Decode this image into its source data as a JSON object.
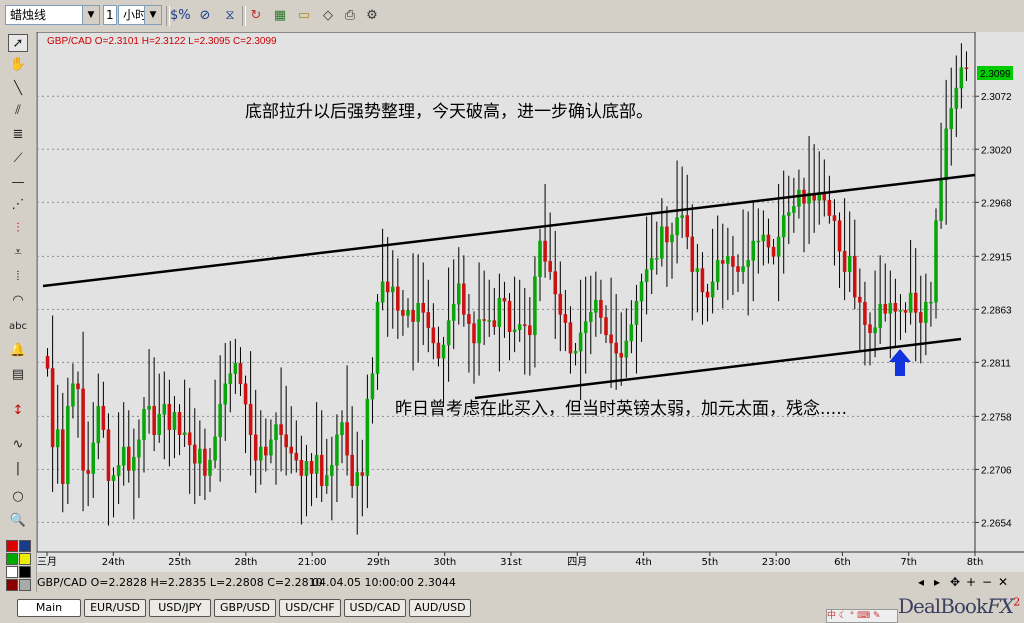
{
  "toolbar": {
    "chart_style": "蜡烛线",
    "period_value": "1",
    "period_unit": "小时",
    "buttons": [
      "percent-icon",
      "percent-strike-icon",
      "crosshair-filter-icon",
      "chart-refresh-icon",
      "add-chart-icon",
      "folder-icon",
      "print-icon",
      "settings-icon"
    ]
  },
  "left_tools": [
    "cursor",
    "hand",
    "line",
    "parallel-lines",
    "fibonacci",
    "fan",
    "horizontal-line",
    "gann-fan",
    "andrews-pitchfork",
    "regression",
    "cycles",
    "text",
    "alert",
    "calculator",
    "arrows",
    "wave",
    "vertical-line",
    "ellipse",
    "zoom"
  ],
  "colors": {
    "chart_bg": "#e2e2e2",
    "bull": "#0aa50a",
    "bear": "#cc1111",
    "grid": "#8c8c8c",
    "price_box": "#00cc00",
    "arrow": "#1133dd",
    "header_text": "#cc0000"
  },
  "chart_data": {
    "type": "candlestick",
    "header": "GBP/CAD O=2.3101 H=2.3122 L=2.3095 C=2.3099",
    "current_price": "2.3099",
    "y_ticks": [
      "2.3072",
      "2.3020",
      "2.2968",
      "2.2915",
      "2.2863",
      "2.2811",
      "2.2758",
      "2.2706",
      "2.2654"
    ],
    "x_ticks": [
      "三月",
      "24th",
      "25th",
      "28th",
      "21:00",
      "29th",
      "30th",
      "31st",
      "四月",
      "4th",
      "5th",
      "23:00",
      "6th",
      "7th",
      "8th"
    ],
    "ylim": [
      2.2625,
      2.3135
    ],
    "annotation_top": "底部拉升以后强势整理，今天破高，进一步确认底部。",
    "annotation_bottom": "昨日曾考虑在此买入，但当时英镑太弱，加元太面，残念.....",
    "closes": [
      2.2805,
      2.2728,
      2.2745,
      2.2692,
      2.2768,
      2.279,
      2.2785,
      2.2705,
      2.2702,
      2.2732,
      2.2768,
      2.2745,
      2.2695,
      2.27,
      2.271,
      2.2728,
      2.2705,
      2.2718,
      2.2735,
      2.2765,
      2.2768,
      2.274,
      2.276,
      2.277,
      2.2745,
      2.2762,
      2.274,
      2.2742,
      2.273,
      2.2712,
      2.2726,
      2.27,
      2.2715,
      2.2738,
      2.277,
      2.279,
      2.28,
      2.281,
      2.279,
      2.277,
      2.274,
      2.2715,
      2.2728,
      2.272,
      2.2735,
      2.275,
      2.274,
      2.2728,
      2.2722,
      2.2715,
      2.27,
      2.2714,
      2.2702,
      2.272,
      2.269,
      2.27,
      2.271,
      2.274,
      2.2752,
      2.272,
      2.269,
      2.2703,
      2.27,
      2.2775,
      2.28,
      2.287,
      2.289,
      2.288,
      2.2885,
      2.2862,
      2.2857,
      2.2862,
      2.2851,
      2.2869,
      2.286,
      2.2845,
      2.283,
      2.2815,
      2.2828,
      2.2852,
      2.2868,
      2.2888,
      2.2858,
      2.2849,
      2.283,
      2.2853,
      2.2852,
      2.2852,
      2.2846,
      2.2874,
      2.2871,
      2.2841,
      2.2843,
      2.2848,
      2.2847,
      2.2838,
      2.2895,
      2.293,
      2.291,
      2.29,
      2.2878,
      2.2858,
      2.285,
      2.282,
      2.2822,
      2.284,
      2.2851,
      2.286,
      2.2872,
      2.2855,
      2.2838,
      2.283,
      2.282,
      2.2816,
      2.2832,
      2.2848,
      2.2871,
      2.289,
      2.2902,
      2.2913,
      2.2913,
      2.2944,
      2.2929,
      2.2936,
      2.2953,
      2.2955,
      2.2934,
      2.29,
      2.2903,
      2.288,
      2.2875,
      2.289,
      2.2911,
      2.2908,
      2.2915,
      2.2905,
      2.29,
      2.2905,
      2.2911,
      2.293,
      2.293,
      2.2936,
      2.2924,
      2.2915,
      2.2934,
      2.2955,
      2.2958,
      2.2964,
      2.298,
      2.2967,
      2.2977,
      2.297,
      2.2978,
      2.297,
      2.2955,
      2.295,
      2.292,
      2.29,
      2.2915,
      2.2875,
      2.287,
      2.2848,
      2.284,
      2.2845,
      2.2868,
      2.2859,
      2.2869,
      2.2861,
      2.2862,
      2.286,
      2.2879,
      2.286,
      2.285,
      2.287,
      2.287,
      2.295,
      2.299,
      2.304,
      2.306,
      2.308,
      2.31,
      2.3099
    ]
  },
  "status": {
    "left": "GBP/CAD O=2.2828 H=2.2835 L=2.2808 C=2.2810",
    "right": "04.04.05 10:00:00 2.3044"
  },
  "nav_icons": [
    "scroll-left-icon",
    "scroll-right-icon",
    "zoom-in-icon",
    "zoom-out-icon"
  ],
  "tabs": [
    "Main",
    "EUR/USD",
    "USD/JPY",
    "GBP/USD",
    "USD/CHF",
    "USD/CAD",
    "AUD/USD"
  ],
  "brand": {
    "name": "DealBook",
    "suffix": "FX",
    "version": "2"
  }
}
